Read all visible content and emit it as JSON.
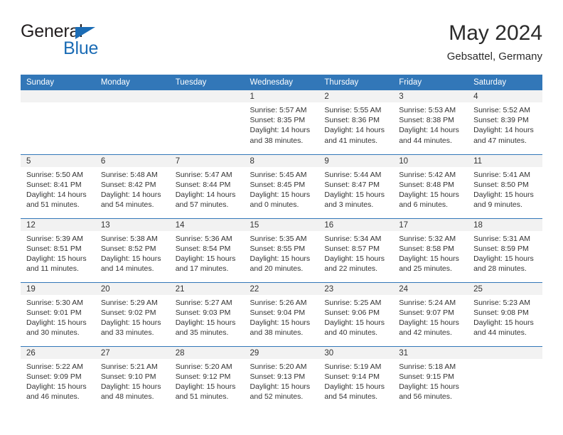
{
  "brand": {
    "line1": "General",
    "line2": "Blue",
    "accent_color": "#1b6cb5",
    "triangle_icon": "triangle-icon"
  },
  "header": {
    "title": "May 2024",
    "subtitle": "Gebsattel, Germany"
  },
  "theme": {
    "header_blue": "#3277b8",
    "band_gray": "#f2f2f2",
    "text": "#333333"
  },
  "weekday_headers": [
    "Sunday",
    "Monday",
    "Tuesday",
    "Wednesday",
    "Thursday",
    "Friday",
    "Saturday"
  ],
  "weeks": [
    [
      {
        "day": "",
        "sunrise": "",
        "sunset": "",
        "daylight_1": "",
        "daylight_2": ""
      },
      {
        "day": "",
        "sunrise": "",
        "sunset": "",
        "daylight_1": "",
        "daylight_2": ""
      },
      {
        "day": "",
        "sunrise": "",
        "sunset": "",
        "daylight_1": "",
        "daylight_2": ""
      },
      {
        "day": "1",
        "sunrise": "Sunrise: 5:57 AM",
        "sunset": "Sunset: 8:35 PM",
        "daylight_1": "Daylight: 14 hours",
        "daylight_2": "and 38 minutes."
      },
      {
        "day": "2",
        "sunrise": "Sunrise: 5:55 AM",
        "sunset": "Sunset: 8:36 PM",
        "daylight_1": "Daylight: 14 hours",
        "daylight_2": "and 41 minutes."
      },
      {
        "day": "3",
        "sunrise": "Sunrise: 5:53 AM",
        "sunset": "Sunset: 8:38 PM",
        "daylight_1": "Daylight: 14 hours",
        "daylight_2": "and 44 minutes."
      },
      {
        "day": "4",
        "sunrise": "Sunrise: 5:52 AM",
        "sunset": "Sunset: 8:39 PM",
        "daylight_1": "Daylight: 14 hours",
        "daylight_2": "and 47 minutes."
      }
    ],
    [
      {
        "day": "5",
        "sunrise": "Sunrise: 5:50 AM",
        "sunset": "Sunset: 8:41 PM",
        "daylight_1": "Daylight: 14 hours",
        "daylight_2": "and 51 minutes."
      },
      {
        "day": "6",
        "sunrise": "Sunrise: 5:48 AM",
        "sunset": "Sunset: 8:42 PM",
        "daylight_1": "Daylight: 14 hours",
        "daylight_2": "and 54 minutes."
      },
      {
        "day": "7",
        "sunrise": "Sunrise: 5:47 AM",
        "sunset": "Sunset: 8:44 PM",
        "daylight_1": "Daylight: 14 hours",
        "daylight_2": "and 57 minutes."
      },
      {
        "day": "8",
        "sunrise": "Sunrise: 5:45 AM",
        "sunset": "Sunset: 8:45 PM",
        "daylight_1": "Daylight: 15 hours",
        "daylight_2": "and 0 minutes."
      },
      {
        "day": "9",
        "sunrise": "Sunrise: 5:44 AM",
        "sunset": "Sunset: 8:47 PM",
        "daylight_1": "Daylight: 15 hours",
        "daylight_2": "and 3 minutes."
      },
      {
        "day": "10",
        "sunrise": "Sunrise: 5:42 AM",
        "sunset": "Sunset: 8:48 PM",
        "daylight_1": "Daylight: 15 hours",
        "daylight_2": "and 6 minutes."
      },
      {
        "day": "11",
        "sunrise": "Sunrise: 5:41 AM",
        "sunset": "Sunset: 8:50 PM",
        "daylight_1": "Daylight: 15 hours",
        "daylight_2": "and 9 minutes."
      }
    ],
    [
      {
        "day": "12",
        "sunrise": "Sunrise: 5:39 AM",
        "sunset": "Sunset: 8:51 PM",
        "daylight_1": "Daylight: 15 hours",
        "daylight_2": "and 11 minutes."
      },
      {
        "day": "13",
        "sunrise": "Sunrise: 5:38 AM",
        "sunset": "Sunset: 8:52 PM",
        "daylight_1": "Daylight: 15 hours",
        "daylight_2": "and 14 minutes."
      },
      {
        "day": "14",
        "sunrise": "Sunrise: 5:36 AM",
        "sunset": "Sunset: 8:54 PM",
        "daylight_1": "Daylight: 15 hours",
        "daylight_2": "and 17 minutes."
      },
      {
        "day": "15",
        "sunrise": "Sunrise: 5:35 AM",
        "sunset": "Sunset: 8:55 PM",
        "daylight_1": "Daylight: 15 hours",
        "daylight_2": "and 20 minutes."
      },
      {
        "day": "16",
        "sunrise": "Sunrise: 5:34 AM",
        "sunset": "Sunset: 8:57 PM",
        "daylight_1": "Daylight: 15 hours",
        "daylight_2": "and 22 minutes."
      },
      {
        "day": "17",
        "sunrise": "Sunrise: 5:32 AM",
        "sunset": "Sunset: 8:58 PM",
        "daylight_1": "Daylight: 15 hours",
        "daylight_2": "and 25 minutes."
      },
      {
        "day": "18",
        "sunrise": "Sunrise: 5:31 AM",
        "sunset": "Sunset: 8:59 PM",
        "daylight_1": "Daylight: 15 hours",
        "daylight_2": "and 28 minutes."
      }
    ],
    [
      {
        "day": "19",
        "sunrise": "Sunrise: 5:30 AM",
        "sunset": "Sunset: 9:01 PM",
        "daylight_1": "Daylight: 15 hours",
        "daylight_2": "and 30 minutes."
      },
      {
        "day": "20",
        "sunrise": "Sunrise: 5:29 AM",
        "sunset": "Sunset: 9:02 PM",
        "daylight_1": "Daylight: 15 hours",
        "daylight_2": "and 33 minutes."
      },
      {
        "day": "21",
        "sunrise": "Sunrise: 5:27 AM",
        "sunset": "Sunset: 9:03 PM",
        "daylight_1": "Daylight: 15 hours",
        "daylight_2": "and 35 minutes."
      },
      {
        "day": "22",
        "sunrise": "Sunrise: 5:26 AM",
        "sunset": "Sunset: 9:04 PM",
        "daylight_1": "Daylight: 15 hours",
        "daylight_2": "and 38 minutes."
      },
      {
        "day": "23",
        "sunrise": "Sunrise: 5:25 AM",
        "sunset": "Sunset: 9:06 PM",
        "daylight_1": "Daylight: 15 hours",
        "daylight_2": "and 40 minutes."
      },
      {
        "day": "24",
        "sunrise": "Sunrise: 5:24 AM",
        "sunset": "Sunset: 9:07 PM",
        "daylight_1": "Daylight: 15 hours",
        "daylight_2": "and 42 minutes."
      },
      {
        "day": "25",
        "sunrise": "Sunrise: 5:23 AM",
        "sunset": "Sunset: 9:08 PM",
        "daylight_1": "Daylight: 15 hours",
        "daylight_2": "and 44 minutes."
      }
    ],
    [
      {
        "day": "26",
        "sunrise": "Sunrise: 5:22 AM",
        "sunset": "Sunset: 9:09 PM",
        "daylight_1": "Daylight: 15 hours",
        "daylight_2": "and 46 minutes."
      },
      {
        "day": "27",
        "sunrise": "Sunrise: 5:21 AM",
        "sunset": "Sunset: 9:10 PM",
        "daylight_1": "Daylight: 15 hours",
        "daylight_2": "and 48 minutes."
      },
      {
        "day": "28",
        "sunrise": "Sunrise: 5:20 AM",
        "sunset": "Sunset: 9:12 PM",
        "daylight_1": "Daylight: 15 hours",
        "daylight_2": "and 51 minutes."
      },
      {
        "day": "29",
        "sunrise": "Sunrise: 5:20 AM",
        "sunset": "Sunset: 9:13 PM",
        "daylight_1": "Daylight: 15 hours",
        "daylight_2": "and 52 minutes."
      },
      {
        "day": "30",
        "sunrise": "Sunrise: 5:19 AM",
        "sunset": "Sunset: 9:14 PM",
        "daylight_1": "Daylight: 15 hours",
        "daylight_2": "and 54 minutes."
      },
      {
        "day": "31",
        "sunrise": "Sunrise: 5:18 AM",
        "sunset": "Sunset: 9:15 PM",
        "daylight_1": "Daylight: 15 hours",
        "daylight_2": "and 56 minutes."
      },
      {
        "day": "",
        "sunrise": "",
        "sunset": "",
        "daylight_1": "",
        "daylight_2": ""
      }
    ]
  ]
}
